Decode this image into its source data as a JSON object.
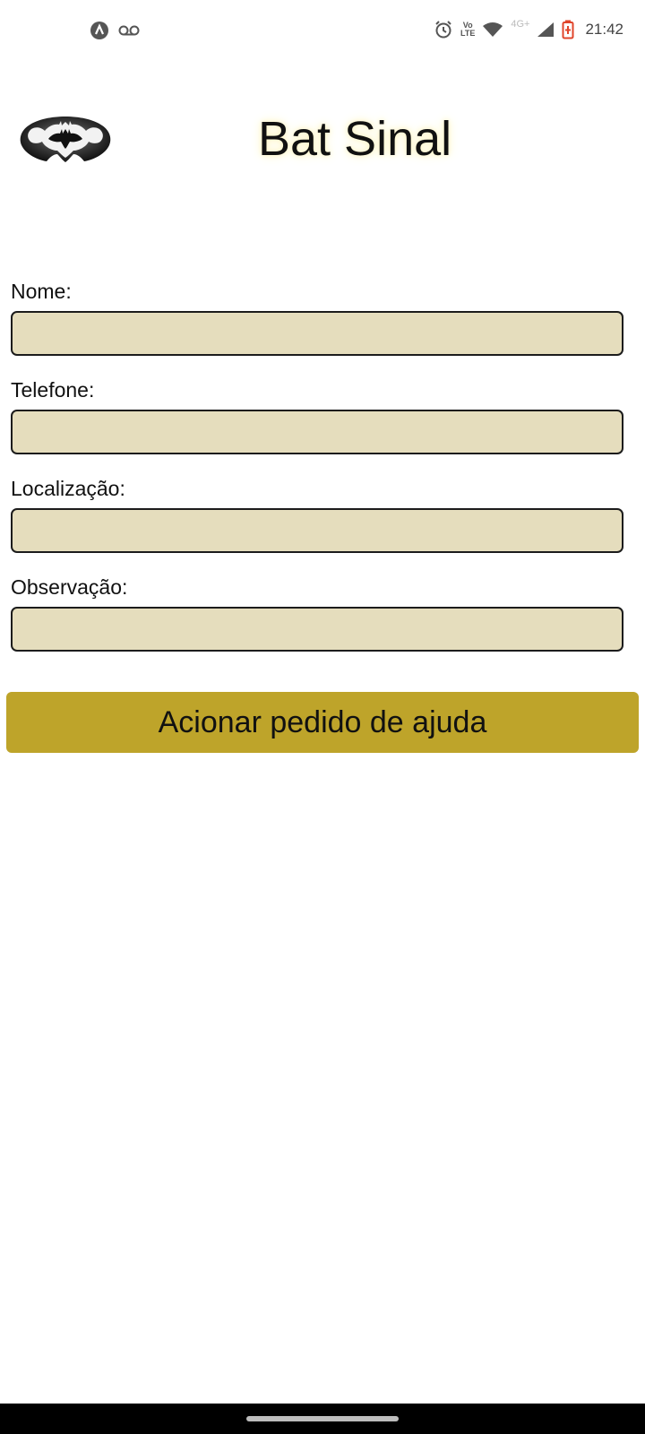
{
  "status_bar": {
    "time": "21:42",
    "network_label": "4G+",
    "volte_label_top": "Vo",
    "volte_label_bottom": "LTE",
    "icons": [
      "app-notification-icon",
      "voicemail-icon",
      "alarm-icon",
      "volte-icon",
      "wifi-icon",
      "cellular-signal-icon",
      "battery-icon"
    ]
  },
  "header": {
    "title": "Bat Sinal",
    "logo": "batman-logo"
  },
  "form": {
    "nome_label": "Nome:",
    "nome_value": "",
    "telefone_label": "Telefone:",
    "telefone_value": "",
    "localizacao_label": "Localização:",
    "localizacao_value": "",
    "observacao_label": "Observação:",
    "observacao_value": "",
    "submit_label": "Acionar pedido de ajuda"
  },
  "colors": {
    "input_background": "#e5ddbd",
    "button_background": "#bea42a",
    "battery_accent": "#e0452b"
  }
}
